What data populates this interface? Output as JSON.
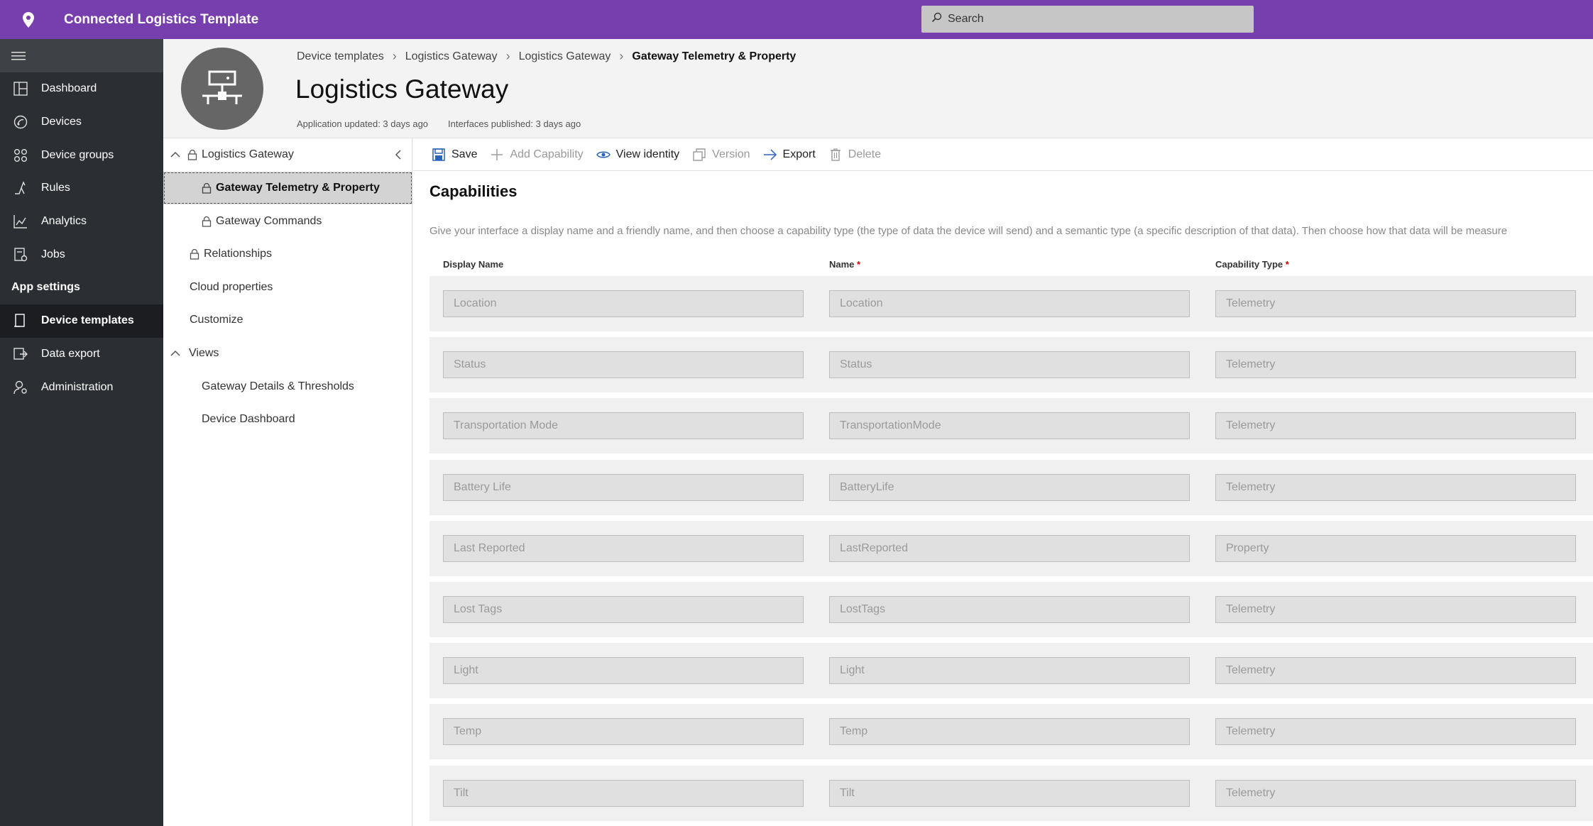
{
  "app": {
    "title": "Connected Logistics Template"
  },
  "search": {
    "label": "Search"
  },
  "nav": {
    "items": [
      {
        "label": "Dashboard",
        "icon": "dashboard-icon"
      },
      {
        "label": "Devices",
        "icon": "devices-icon"
      },
      {
        "label": "Device groups",
        "icon": "device-groups-icon"
      },
      {
        "label": "Rules",
        "icon": "rules-icon"
      },
      {
        "label": "Analytics",
        "icon": "analytics-icon"
      },
      {
        "label": "Jobs",
        "icon": "jobs-icon"
      }
    ],
    "section": "App settings",
    "settings_items": [
      {
        "label": "Device templates",
        "icon": "device-templates-icon",
        "active": true
      },
      {
        "label": "Data export",
        "icon": "data-export-icon"
      },
      {
        "label": "Administration",
        "icon": "administration-icon"
      }
    ]
  },
  "breadcrumb": [
    "Device templates",
    "Logistics Gateway",
    "Logistics Gateway",
    "Gateway Telemetry & Property"
  ],
  "page": {
    "title": "Logistics Gateway",
    "app_updated": "Application updated: 3 days ago",
    "interfaces_published": "Interfaces published: 3 days ago"
  },
  "tree": [
    {
      "label": "Logistics Gateway",
      "lock": true,
      "chevron": true
    },
    {
      "label": "Gateway Telemetry & Property",
      "lock": true,
      "selected": true
    },
    {
      "label": "Gateway Commands",
      "lock": true
    },
    {
      "label": "Relationships",
      "lock": true
    },
    {
      "label": "Cloud properties"
    },
    {
      "label": "Customize"
    },
    {
      "label": "Views",
      "chevron": true
    },
    {
      "label": "Gateway Details & Thresholds"
    },
    {
      "label": "Device Dashboard"
    }
  ],
  "toolbar": {
    "save": "Save",
    "add_capability": "Add Capability",
    "view_identity": "View identity",
    "version": "Version",
    "export": "Export",
    "delete": "Delete"
  },
  "capabilities": {
    "title": "Capabilities",
    "description": "Give your interface a display name and a friendly name, and then choose a capability type (the type of data the device will send) and a semantic type (a specific description of that data). Then choose how that data will be measure",
    "columns": {
      "display_name": "Display Name",
      "name": "Name",
      "capability_type": "Capability Type",
      "required_mark": "*"
    },
    "rows": [
      {
        "display_name": "Location",
        "name": "Location",
        "type": "Telemetry"
      },
      {
        "display_name": "Status",
        "name": "Status",
        "type": "Telemetry"
      },
      {
        "display_name": "Transportation Mode",
        "name": "TransportationMode",
        "type": "Telemetry"
      },
      {
        "display_name": "Battery Life",
        "name": "BatteryLife",
        "type": "Telemetry"
      },
      {
        "display_name": "Last Reported",
        "name": "LastReported",
        "type": "Property"
      },
      {
        "display_name": "Lost Tags",
        "name": "LostTags",
        "type": "Telemetry"
      },
      {
        "display_name": "Light",
        "name": "Light",
        "type": "Telemetry"
      },
      {
        "display_name": "Temp",
        "name": "Temp",
        "type": "Telemetry"
      },
      {
        "display_name": "Tilt",
        "name": "Tilt",
        "type": "Telemetry"
      }
    ]
  }
}
